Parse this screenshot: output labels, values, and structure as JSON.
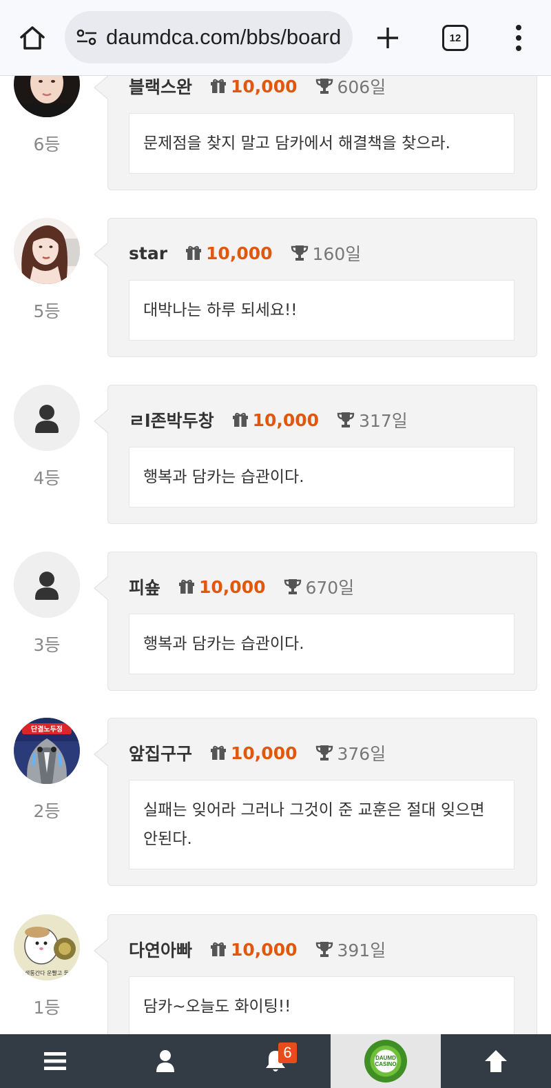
{
  "browser": {
    "url": "daumdca.com/bbs/board",
    "tab_count": "12"
  },
  "comments": [
    {
      "nick": "블랙스완",
      "points": "10,000",
      "days": "606일",
      "message": "문제점을 찾지 말고 담카에서 해결책을 찾으라.",
      "rank": "6등",
      "avatar": "photo-woman-dark-hair"
    },
    {
      "nick": "star",
      "points": "10,000",
      "days": "160일",
      "message": "대박나는 하루 되세요!!",
      "rank": "5등",
      "avatar": "photo-woman-long-hair"
    },
    {
      "nick": "ㄹl존박두창",
      "points": "10,000",
      "days": "317일",
      "message": "행복과 담카는 습관이다.",
      "rank": "4등",
      "avatar": "default-user"
    },
    {
      "nick": "피숖",
      "points": "10,000",
      "days": "670일",
      "message": "행복과 담카는 습관이다.",
      "rank": "3등",
      "avatar": "default-user"
    },
    {
      "nick": "앞집구구",
      "points": "10,000",
      "days": "376일",
      "message": "실패는 잊어라 그러나 그것이 준 교훈은 절대 잊으면 안된다.",
      "rank": "2등",
      "avatar": "cartoon-pigeon"
    },
    {
      "nick": "다연아빠",
      "points": "10,000",
      "days": "391일",
      "message": "담카~오늘도 화이팅!!",
      "rank": "1등",
      "avatar": "cartoon-hamster"
    }
  ],
  "avatar_labels": {
    "pigeon": "단결노두정",
    "hamster": "생통간다 운빨고 돌"
  },
  "bottom_nav": {
    "notification_count": "6",
    "logo_line1": "DAUMD",
    "logo_line2": "CASINO"
  },
  "colors": {
    "points": "#e0570e",
    "nav_bg": "#333b45",
    "badge": "#e74c1a"
  }
}
